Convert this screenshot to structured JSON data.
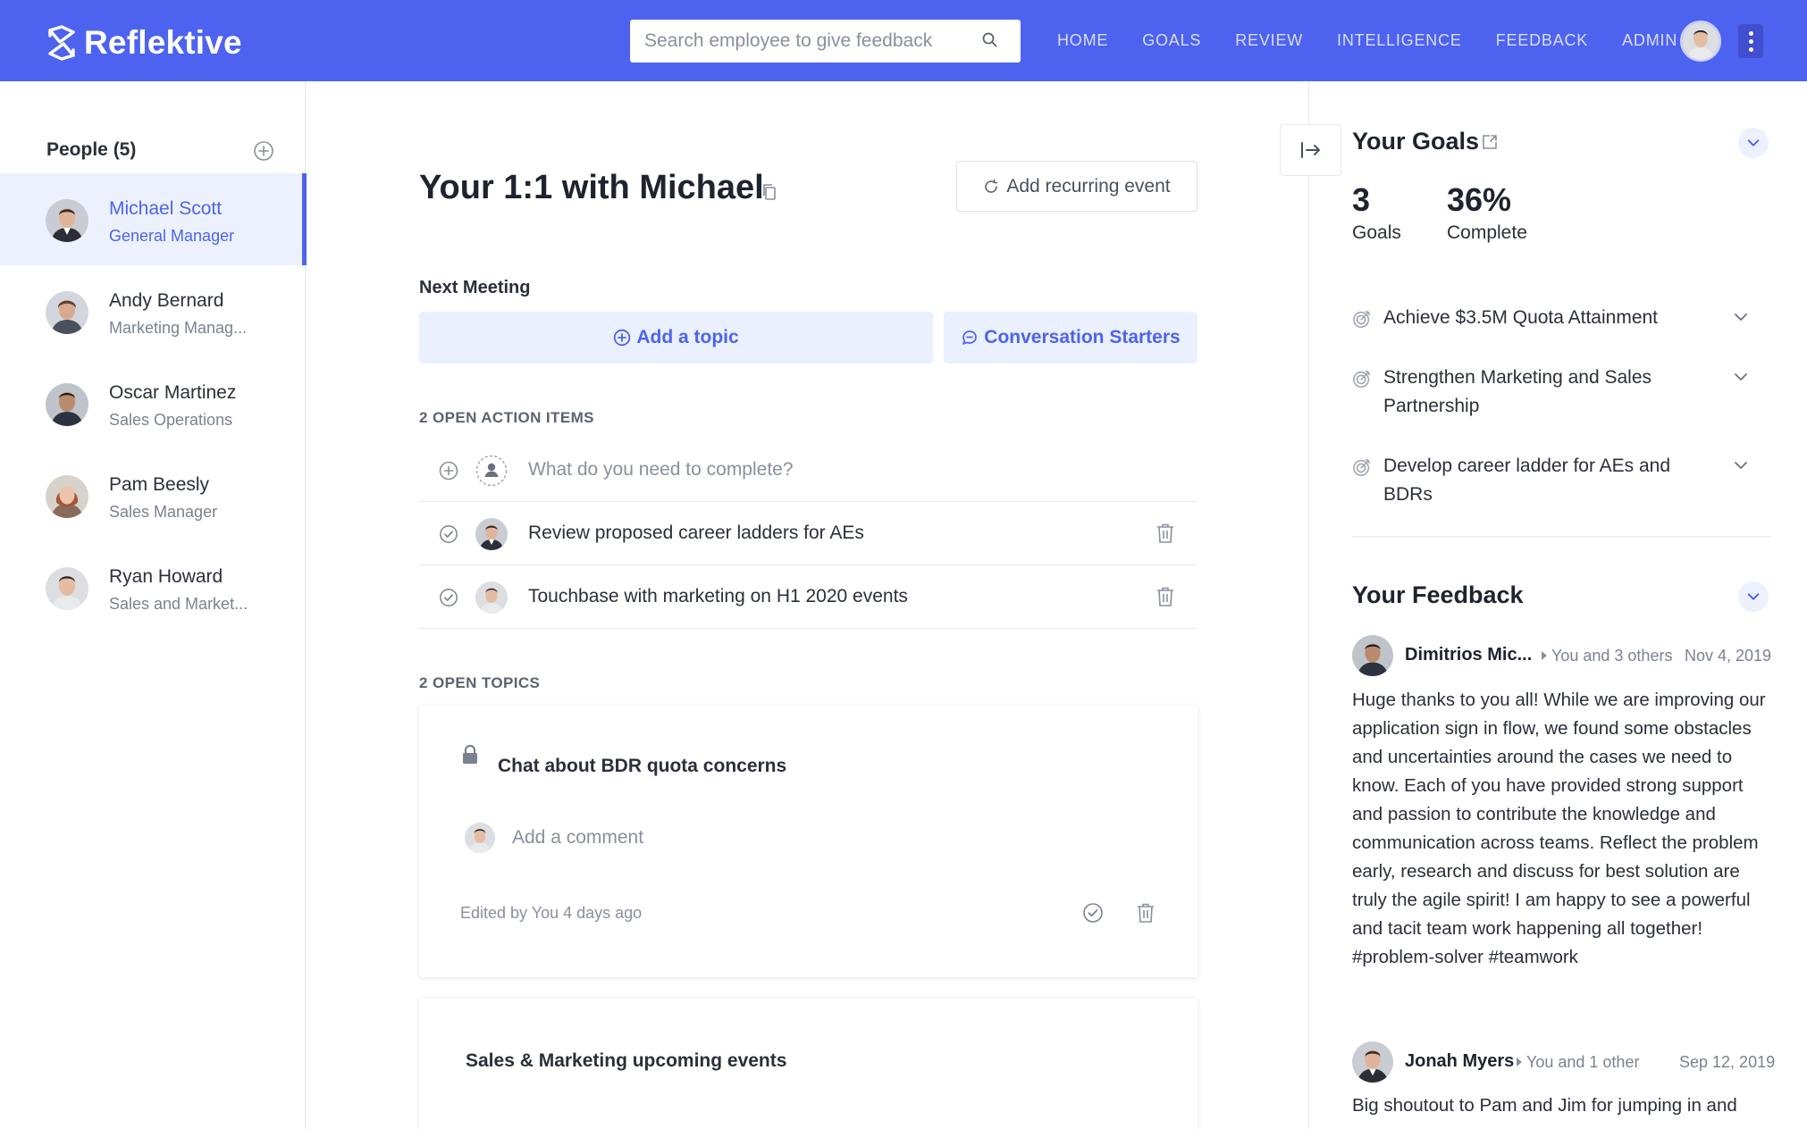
{
  "header": {
    "brand": "Reflektive",
    "search_placeholder": "Search employee to give feedback",
    "nav": [
      "HOME",
      "GOALS",
      "REVIEW",
      "INTELLIGENCE",
      "FEEDBACK",
      "ADMIN"
    ],
    "accent_color": "#4d63f0"
  },
  "sidebar": {
    "title": "People (5)",
    "people": [
      {
        "name": "Michael Scott",
        "role": "General Manager",
        "active": true
      },
      {
        "name": "Andy Bernard",
        "role": "Marketing Manag..."
      },
      {
        "name": "Oscar Martinez",
        "role": "Sales Operations"
      },
      {
        "name": "Pam Beesly",
        "role": "Sales Manager"
      },
      {
        "name": "Ryan Howard",
        "role": "Sales and Market..."
      }
    ]
  },
  "main": {
    "title": "Your 1:1 with Michael",
    "recurring_button": "Add recurring event",
    "next_meeting_label": "Next Meeting",
    "add_topic_button": "Add a topic",
    "conversation_button": "Conversation Starters",
    "action_items_label": "2 OPEN ACTION ITEMS",
    "action_input_placeholder": "What do you need to complete?",
    "action_items": [
      "Review proposed career ladders for AEs",
      "Touchbase with marketing on H1 2020 events"
    ],
    "topics_label": "2 OPEN TOPICS",
    "topics": [
      {
        "title": "Chat about BDR quota concerns",
        "comment_placeholder": "Add a comment",
        "edited": "Edited by You 4 days ago"
      },
      {
        "title": "Sales & Marketing upcoming events"
      }
    ]
  },
  "goals": {
    "title": "Your Goals",
    "count": "3",
    "count_label": "Goals",
    "percent": "36%",
    "percent_label": "Complete",
    "items": [
      "Achieve $3.5M Quota Attainment",
      "Strengthen Marketing and Sales Partnership",
      "Develop career ladder for AEs and BDRs"
    ]
  },
  "feedback": {
    "title": "Your Feedback",
    "items": [
      {
        "author": "Dimitrios Mic...",
        "to": "You and 3 others",
        "date": "Nov 4, 2019",
        "body": "Huge thanks to you all! While we are improving our application sign in flow, we found some obstacles and uncertainties around the cases we need to know. Each of you have provided strong support and passion to contribute the knowledge and communication across teams. Reflect the problem early, research and discuss for best solution are truly the agile spirit! I am happy to see a powerful and tacit team work happening all together! #problem-solver #teamwork"
      },
      {
        "author": "Jonah Myers",
        "to": "You and 1 other",
        "date": "Sep 12, 2019",
        "body": "Big shoutout to Pam and Jim for jumping in and"
      }
    ]
  }
}
